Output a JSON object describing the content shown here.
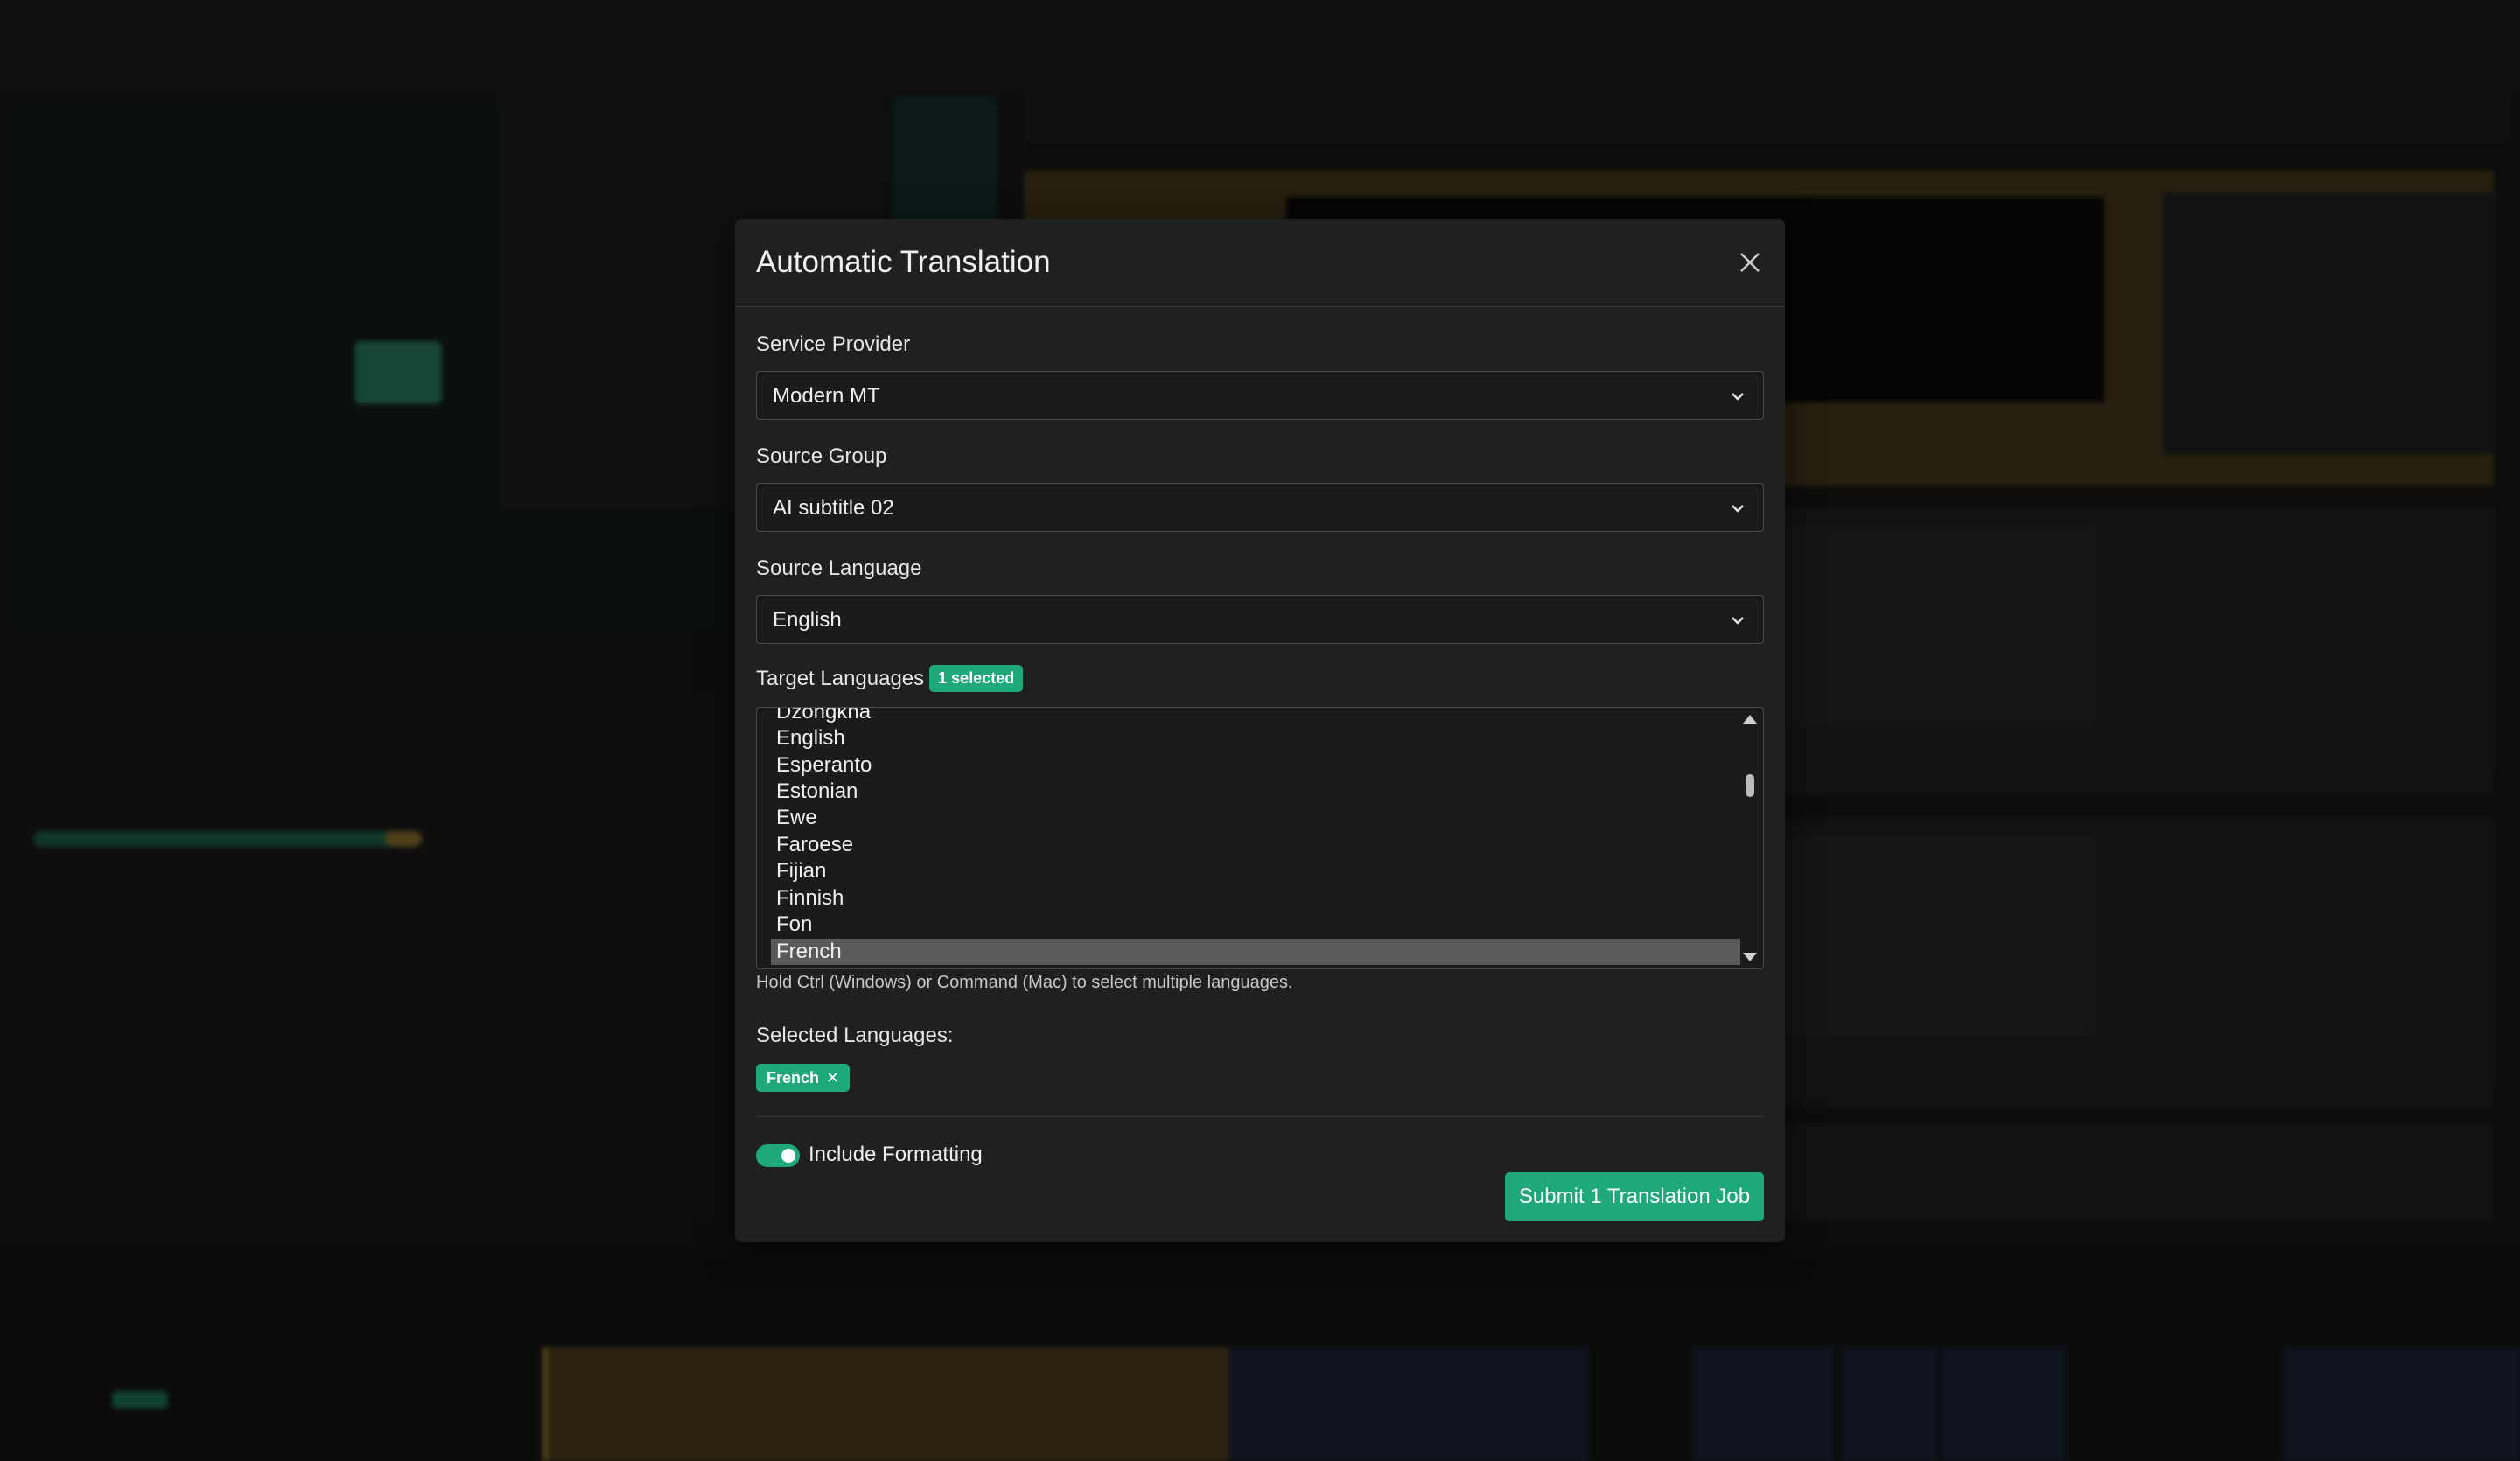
{
  "dialog": {
    "title": "Automatic Translation",
    "service_provider": {
      "label": "Service Provider",
      "value": "Modern MT"
    },
    "source_group": {
      "label": "Source Group",
      "value": "AI subtitle 02"
    },
    "source_language": {
      "label": "Source Language",
      "value": "English"
    },
    "target_languages": {
      "label": "Target Languages",
      "badge": "1 selected",
      "options": [
        "Dzongkha",
        "English",
        "Esperanto",
        "Estonian",
        "Ewe",
        "Faroese",
        "Fijian",
        "Finnish",
        "Fon",
        "French"
      ],
      "selected": "French"
    },
    "hint": "Hold Ctrl (Windows) or Command (Mac) to select multiple languages.",
    "selected_languages": {
      "label": "Selected Languages:",
      "chips": [
        "French"
      ]
    },
    "include_formatting": {
      "label": "Include Formatting",
      "enabled": true
    },
    "submit_label": "Submit 1 Translation Job"
  },
  "colors": {
    "accent": "#1fa878",
    "dialog_bg": "#202020",
    "input_bg": "#1b1b1b"
  }
}
